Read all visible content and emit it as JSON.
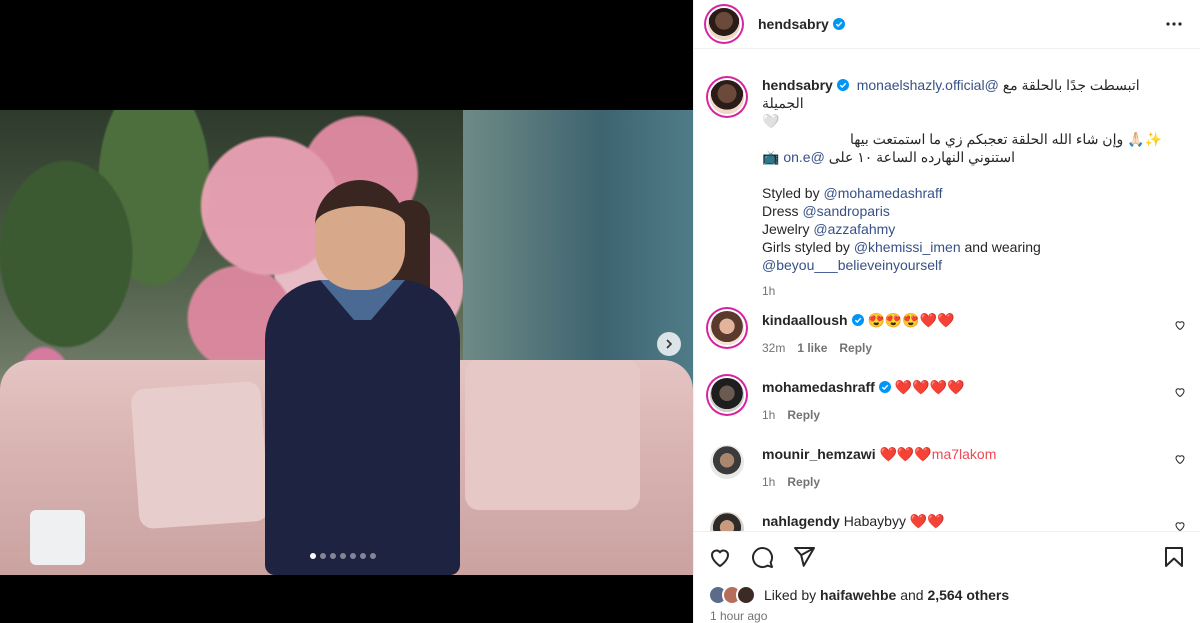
{
  "header": {
    "username": "hendsabry",
    "verified": true,
    "more_icon": "more-horizontal-icon"
  },
  "post": {
    "carousel_dots": 7,
    "active_dot": 0,
    "caption": {
      "username": "hendsabry",
      "line1_mention": "monaelshazly.official@",
      "line1_text": "اتبسطت جدًا بالحلقة مع الجميلة",
      "line1_emoji": "🤍",
      "line2": "✨🙏🏻 وإن شاء الله الحلقة تعجبكم زي ما استمتعت بيها",
      "line3_icon": "📺",
      "line3_mention": "on.e@",
      "line3_text": "استنوني النهارده الساعة ١٠ على",
      "styled_by_label": "Styled by",
      "styled_by": "@mohamedashraff",
      "dress_label": "Dress",
      "dress": "@sandroparis",
      "jewelry_label": "Jewelry",
      "jewelry": "@azzafahmy",
      "girls_label": "Girls styled by",
      "girls": "@khemissi_imen",
      "wearing_label": "and wearing",
      "wearing": "@beyou___believeinyourself",
      "time": "1h"
    },
    "comments": [
      {
        "username": "kindaalloush",
        "verified": true,
        "text": "😍😍😍❤️❤️",
        "time": "32m",
        "likes": "1 like",
        "reply": "Reply"
      },
      {
        "username": "mohamedashraff",
        "verified": true,
        "text": "❤️❤️❤️❤️",
        "time": "1h",
        "reply": "Reply"
      },
      {
        "username": "mounir_hemzawi",
        "verified": false,
        "text": "❤️❤️❤️ma7lakom",
        "time": "1h",
        "reply": "Reply"
      },
      {
        "username": "nahlagendy",
        "verified": false,
        "text": "Habaybyy ❤️❤️",
        "time": "",
        "reply": ""
      }
    ],
    "liked_by_label": "Liked by",
    "liked_by_user": "haifawehbe",
    "and_label": "and",
    "others": "2,564 others",
    "posted_time": "1 hour ago"
  },
  "colors": {
    "accent": "#0095f6",
    "mention": "#385185",
    "secondary": "#737373",
    "heart": "#ed4956"
  }
}
